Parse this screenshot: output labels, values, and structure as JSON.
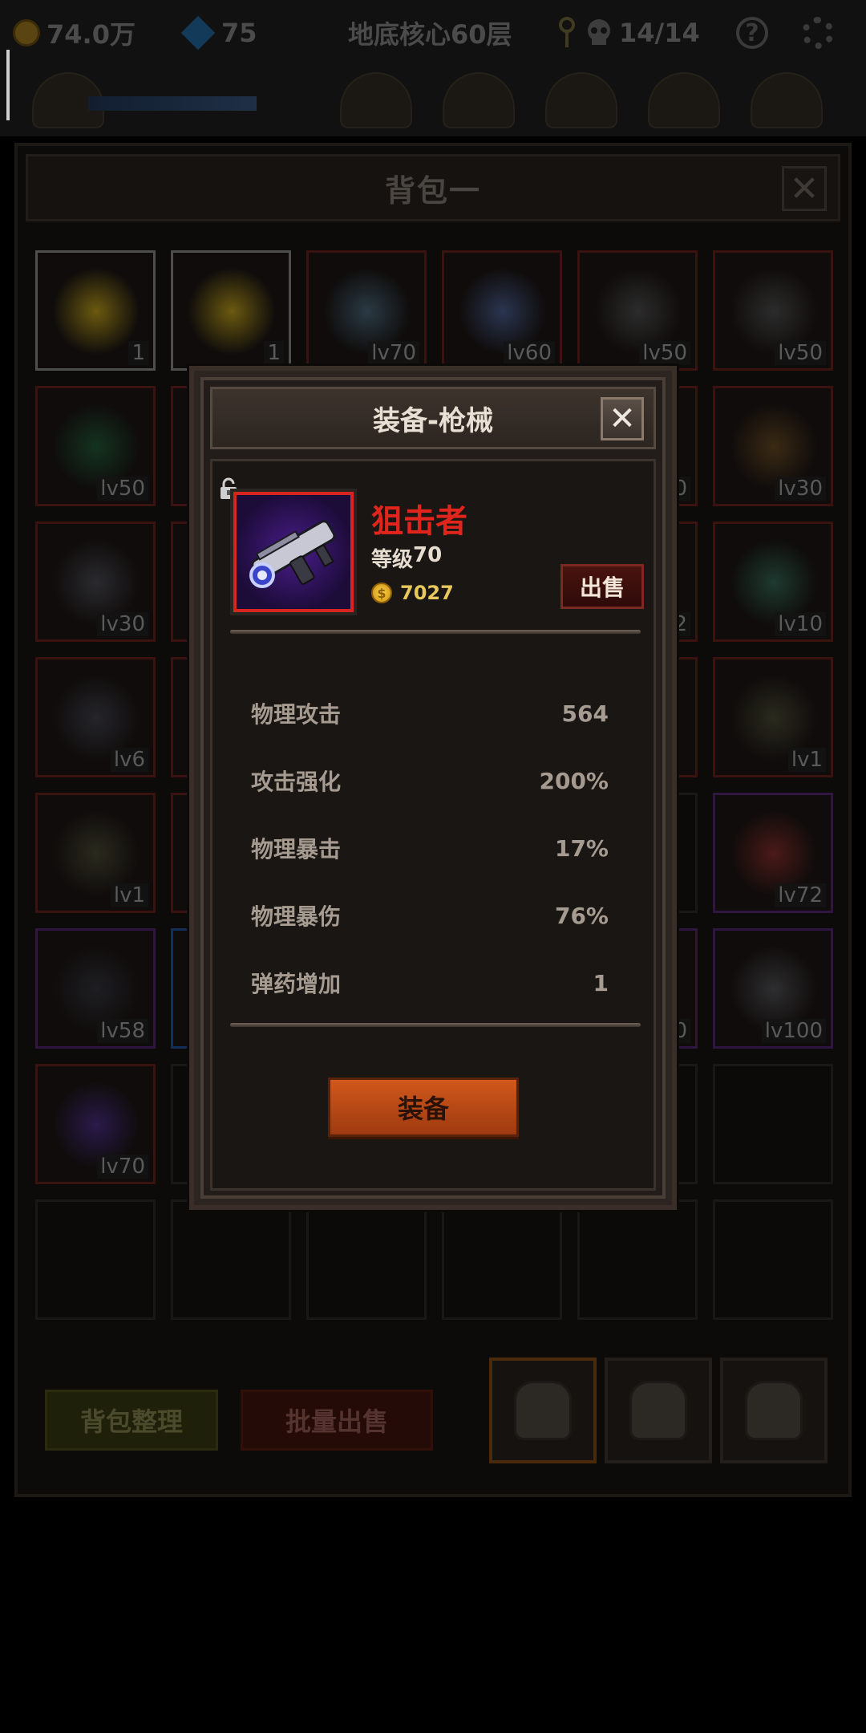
{
  "hud": {
    "gold": "74.0万",
    "gems": "75",
    "floor": "地底核心60层",
    "skulls": "14/14",
    "help": "?"
  },
  "backpack": {
    "title": "背包一",
    "close": "✕",
    "slots": [
      {
        "rarity": "white",
        "icon": "cheese-icon",
        "label": "1"
      },
      {
        "rarity": "white",
        "icon": "cheese-icon",
        "label": "1"
      },
      {
        "rarity": "red",
        "icon": "dagger-icon",
        "label": "lv70"
      },
      {
        "rarity": "red",
        "icon": "axe-icon",
        "label": "lv60"
      },
      {
        "rarity": "red",
        "icon": "spear-icon",
        "label": "lv50"
      },
      {
        "rarity": "red",
        "icon": "spear-icon",
        "label": "lv50"
      },
      {
        "rarity": "red",
        "icon": "cloak-icon",
        "label": "lv50"
      },
      {
        "rarity": "red",
        "icon": "hidden-icon",
        "label": ""
      },
      {
        "rarity": "red",
        "icon": "hidden-icon",
        "label": ""
      },
      {
        "rarity": "red",
        "icon": "hidden-icon",
        "label": ""
      },
      {
        "rarity": "red",
        "icon": "hidden-icon",
        "label": "0"
      },
      {
        "rarity": "red",
        "icon": "bow-icon",
        "label": "lv30"
      },
      {
        "rarity": "red",
        "icon": "armor-icon",
        "label": "lv30"
      },
      {
        "rarity": "red",
        "icon": "hidden-icon",
        "label": ""
      },
      {
        "rarity": "red",
        "icon": "hidden-icon",
        "label": ""
      },
      {
        "rarity": "red",
        "icon": "hidden-icon",
        "label": ""
      },
      {
        "rarity": "red",
        "icon": "hidden-icon",
        "label": "2"
      },
      {
        "rarity": "red",
        "icon": "ring-icon",
        "label": "lv10"
      },
      {
        "rarity": "red",
        "icon": "helmet-icon",
        "label": "lv6"
      },
      {
        "rarity": "red",
        "icon": "hidden-icon",
        "label": ""
      },
      {
        "rarity": "red",
        "icon": "hidden-icon",
        "label": ""
      },
      {
        "rarity": "red",
        "icon": "hidden-icon",
        "label": ""
      },
      {
        "rarity": "red",
        "icon": "hidden-icon",
        "label": ""
      },
      {
        "rarity": "red",
        "icon": "boots-icon",
        "label": "lv1"
      },
      {
        "rarity": "red",
        "icon": "boots-icon",
        "label": "lv1"
      },
      {
        "rarity": "red",
        "icon": "hidden-icon",
        "label": ""
      },
      {
        "rarity": "empty",
        "icon": "",
        "label": ""
      },
      {
        "rarity": "empty",
        "icon": "",
        "label": ""
      },
      {
        "rarity": "empty",
        "icon": "",
        "label": ""
      },
      {
        "rarity": "purple",
        "icon": "shield-icon",
        "label": "lv72"
      },
      {
        "rarity": "purple",
        "icon": "necklace-icon",
        "label": "lv58"
      },
      {
        "rarity": "blue",
        "icon": "hidden-icon",
        "label": ""
      },
      {
        "rarity": "empty",
        "icon": "",
        "label": ""
      },
      {
        "rarity": "empty",
        "icon": "",
        "label": ""
      },
      {
        "rarity": "purple",
        "icon": "hidden-icon",
        "label": "00"
      },
      {
        "rarity": "purple",
        "icon": "knight-helmet-icon",
        "label": "lv100"
      },
      {
        "rarity": "red",
        "icon": "gun-icon",
        "label": "lv70"
      },
      {
        "rarity": "empty",
        "icon": "",
        "label": ""
      },
      {
        "rarity": "empty",
        "icon": "",
        "label": ""
      },
      {
        "rarity": "empty",
        "icon": "",
        "label": ""
      },
      {
        "rarity": "empty",
        "icon": "",
        "label": ""
      },
      {
        "rarity": "empty",
        "icon": "",
        "label": ""
      },
      {
        "rarity": "empty",
        "icon": "",
        "label": ""
      },
      {
        "rarity": "empty",
        "icon": "",
        "label": ""
      },
      {
        "rarity": "empty",
        "icon": "",
        "label": ""
      },
      {
        "rarity": "empty",
        "icon": "",
        "label": ""
      },
      {
        "rarity": "empty",
        "icon": "",
        "label": ""
      },
      {
        "rarity": "empty",
        "icon": "",
        "label": ""
      }
    ],
    "sort_button": "背包整理",
    "bulk_sell_button": "批量出售",
    "tabs": [
      "bag-tab-1",
      "bag-tab-2",
      "bag-tab-3"
    ],
    "active_tab": 0
  },
  "popup": {
    "title": "装备-枪械",
    "close": "✕",
    "item": {
      "name": "狙击者",
      "level_label": "等级",
      "level": "70",
      "price": "7027",
      "coin_symbol": "$",
      "icon": "gun-icon",
      "locked": false
    },
    "sell_button": "出售",
    "stats": [
      {
        "label": "物理攻击",
        "value": "564"
      },
      {
        "label": "攻击强化",
        "value": "200%"
      },
      {
        "label": "物理暴击",
        "value": "17%"
      },
      {
        "label": "物理暴伤",
        "value": "76%"
      },
      {
        "label": "弹药增加",
        "value": "1"
      }
    ],
    "equip_button": "装备"
  },
  "colors": {
    "legendary_border": "#d6261f",
    "item_name": "#e0251d",
    "price": "#e7c95b",
    "equip_button": "#c4511a"
  }
}
